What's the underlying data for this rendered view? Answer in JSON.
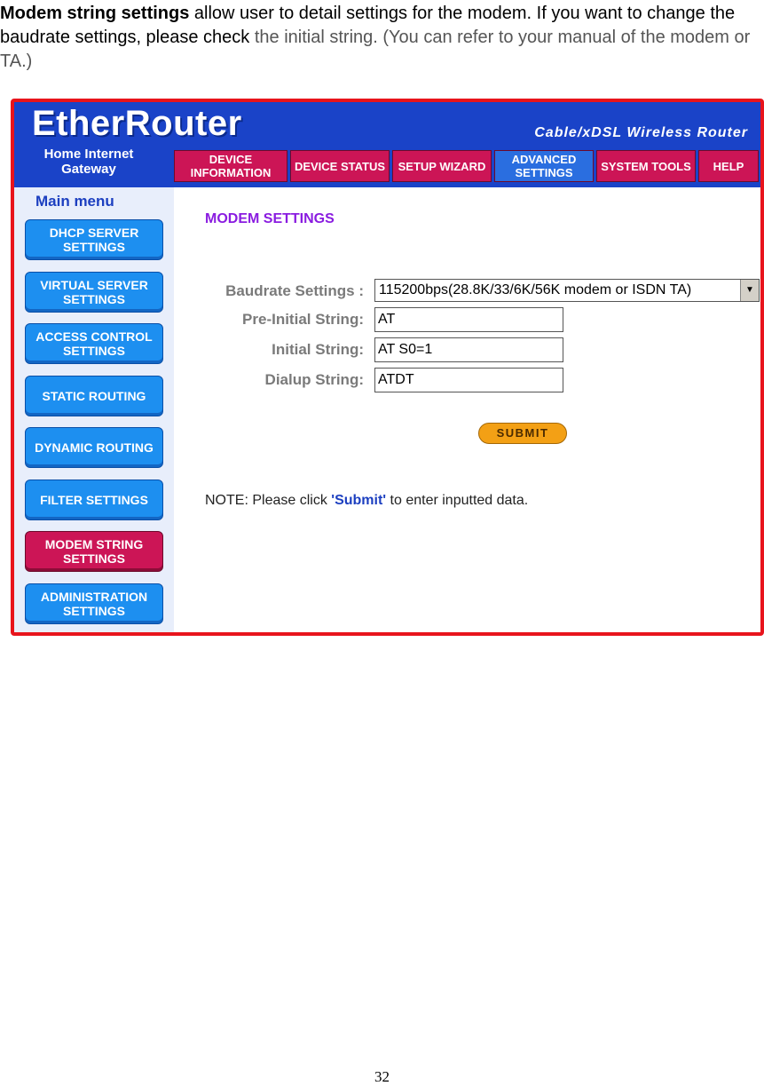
{
  "intro": {
    "lead": "Modem string settings",
    "part1": " allow user to detail settings for the modem. If you want to change the baudrate settings, please check",
    "part2": " the initial string. (You can refer to your manual of the modem or TA.)"
  },
  "header": {
    "brand": "EtherRouter",
    "gateway": "Home Internet Gateway",
    "tagline": "Cable/xDSL Wireless Router"
  },
  "tabs": [
    {
      "label": "DEVICE INFORMATION"
    },
    {
      "label": "DEVICE STATUS"
    },
    {
      "label": "SETUP WIZARD"
    },
    {
      "label": "ADVANCED SETTINGS"
    },
    {
      "label": "SYSTEM TOOLS"
    },
    {
      "label": "HELP"
    }
  ],
  "sidebar": {
    "title": "Main menu",
    "items": [
      {
        "label": "DHCP SERVER SETTINGS"
      },
      {
        "label": "VIRTUAL SERVER SETTINGS"
      },
      {
        "label": "ACCESS CONTROL SETTINGS"
      },
      {
        "label": "STATIC ROUTING"
      },
      {
        "label": "DYNAMIC ROUTING"
      },
      {
        "label": "FILTER SETTINGS"
      },
      {
        "label": "MODEM STRING SETTINGS"
      },
      {
        "label": "ADMINISTRATION SETTINGS"
      }
    ]
  },
  "main": {
    "title": "MODEM SETTINGS",
    "baudrate_label": "Baudrate Settings :",
    "baudrate_value": "115200bps(28.8K/33/6K/56K modem or ISDN TA)",
    "preinitial_label": "Pre-Initial String:",
    "preinitial_value": "AT",
    "initial_label": "Initial String:",
    "initial_value": "AT S0=1",
    "dialup_label": "Dialup String:",
    "dialup_value": "ATDT",
    "submit_label": "SUBMIT",
    "note_prefix": "NOTE: Please click ",
    "note_quote": "'Submit'",
    "note_suffix": " to enter inputted data."
  },
  "page_number": "32"
}
